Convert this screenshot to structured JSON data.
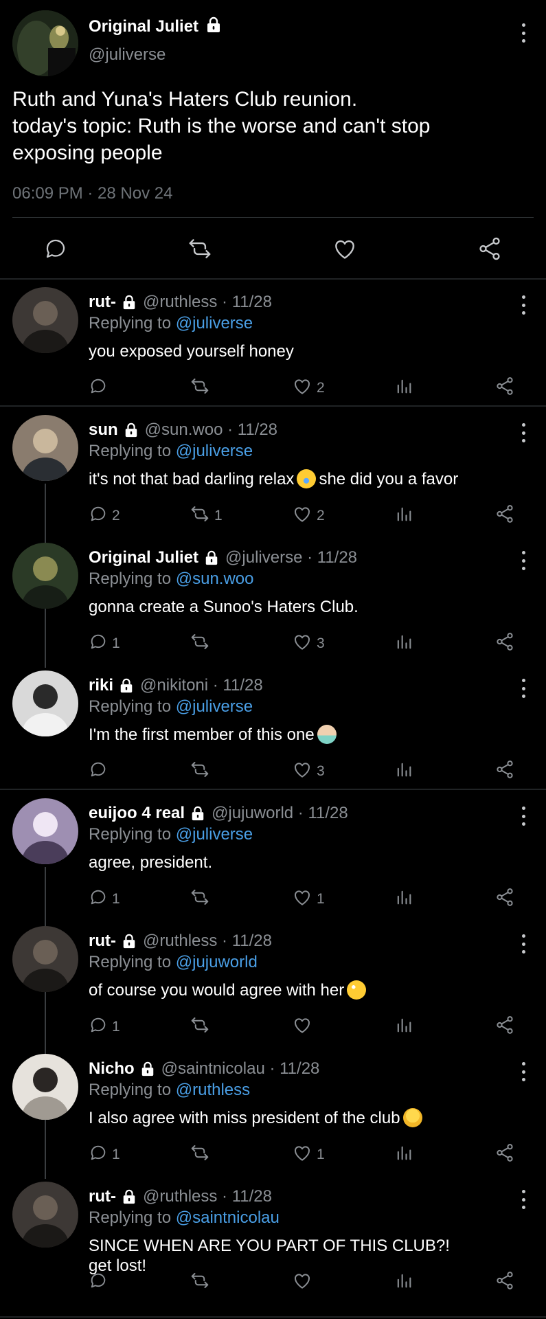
{
  "main_tweet": {
    "name": "Original Juliet",
    "handle": "@juliverse",
    "text_line1": "Ruth and Yuna's Haters Club reunion.",
    "text_line2": "today's topic: Ruth is the worse and can't stop",
    "text_line3": "exposing people",
    "timestamp": "06:09 PM · 28 Nov 24"
  },
  "replies": [
    {
      "name": "rut-",
      "handle": "@ruthless · 11/28",
      "replying_prefix": "Replying to ",
      "replying_to": "@juliverse",
      "text": "you exposed yourself honey",
      "reply_count": "",
      "retweet_count": "",
      "like_count": "2"
    },
    {
      "name": "sun",
      "handle": "@sun.woo · 11/28",
      "replying_prefix": "Replying to ",
      "replying_to": "@juliverse",
      "text_a": "it's not that bad darling relax",
      "emoji": "crying-face-emoji",
      "text_b": "she did you a favor",
      "reply_count": "2",
      "retweet_count": "1",
      "like_count": "2"
    },
    {
      "name": "Original Juliet",
      "handle": "@juliverse · 11/28",
      "replying_prefix": "Replying to ",
      "replying_to": "@sun.woo",
      "text": "gonna create a Sunoo's Haters Club.",
      "reply_count": "1",
      "retweet_count": "",
      "like_count": "3"
    },
    {
      "name": "riki",
      "handle": "@nikitoni · 11/28",
      "replying_prefix": "Replying to ",
      "replying_to": "@juliverse",
      "text": "I'm the first member of this one",
      "emoji": "person-raising-hand-emoji",
      "reply_count": "",
      "retweet_count": "",
      "like_count": "3"
    },
    {
      "name": "euijoo 4 real",
      "handle": "@jujuworld · 11/28",
      "replying_prefix": "Replying to ",
      "replying_to": "@juliverse",
      "text": "agree, president.",
      "reply_count": "1",
      "retweet_count": "",
      "like_count": "1"
    },
    {
      "name": "rut-",
      "handle": "@ruthless · 11/28",
      "replying_prefix": "Replying to ",
      "replying_to": "@jujuworld",
      "text": "of course you would agree with her",
      "emoji": "eye-roll-emoji",
      "reply_count": "1",
      "retweet_count": "",
      "like_count": ""
    },
    {
      "name": "Nicho",
      "handle": "@saintnicolau · 11/28",
      "replying_prefix": "Replying to ",
      "replying_to": "@ruthless",
      "text": "I also agree with miss president of the club",
      "emoji": "saluting-face-emoji",
      "reply_count": "1",
      "retweet_count": "",
      "like_count": "1"
    },
    {
      "name": "rut-",
      "handle": "@ruthless · 11/28",
      "replying_prefix": "Replying to ",
      "replying_to": "@saintnicolau",
      "text_line1": "SINCE WHEN ARE YOU PART OF THIS CLUB?!",
      "text_line2": "get lost!",
      "reply_count": "",
      "retweet_count": "",
      "like_count": ""
    }
  ],
  "icons": [
    "lock-icon",
    "more-vertical-icon",
    "reply-icon",
    "retweet-icon",
    "like-icon",
    "analytics-icon",
    "share-icon"
  ],
  "colors": {
    "background": "#000000",
    "text": "#e7e9ea",
    "secondary": "#8b8f94",
    "mention": "#4a9fe6",
    "divider": "#2f3336"
  }
}
